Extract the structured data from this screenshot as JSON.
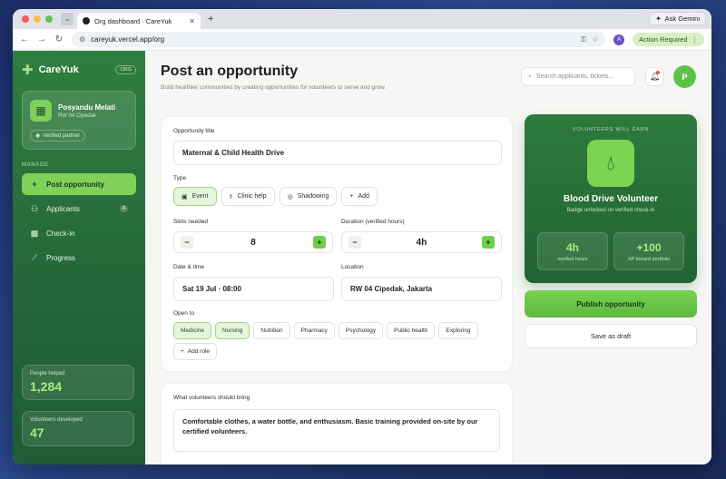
{
  "browser": {
    "tab_title": "Org dashboard · CareYuk",
    "ask_gemini": "Ask Gemini",
    "url": "careyuk.vercel.app/org",
    "profile_initial": "A",
    "action_required": "Action Required"
  },
  "sidebar": {
    "brand": "CareYuk",
    "org_badge": "ORG",
    "org_name": "Posyandu Melati",
    "org_location": "RW 04 Cipedak",
    "verified": "Verified partner",
    "section": "MANAGE",
    "items": [
      {
        "label": "Post opportunity",
        "icon": "+"
      },
      {
        "label": "Applicants",
        "icon": "users",
        "count": "4"
      },
      {
        "label": "Check-in",
        "icon": "qr"
      },
      {
        "label": "Progress",
        "icon": "chart"
      }
    ],
    "stats": [
      {
        "label": "People helped",
        "value": "1,284"
      },
      {
        "label": "Volunteers developed",
        "value": "47"
      }
    ]
  },
  "header": {
    "title": "Post an opportunity",
    "subtitle": "Build healthier communities by creating opportunities for volunteers to serve and grow.",
    "search_placeholder": "Search applicants, tickets...",
    "user_initial": "P"
  },
  "form": {
    "title_label": "Opportunity title",
    "title_value": "Maternal & Child Health Drive",
    "type_label": "Type",
    "types": [
      "Event",
      "Clinic help",
      "Shadowing",
      "Add"
    ],
    "slots_label": "Slots needed",
    "slots_value": "8",
    "duration_label": "Duration (verified hours)",
    "duration_value": "4h",
    "date_label": "Date & time",
    "date_value": "Sat 19 Jul · 08:00",
    "location_label": "Location",
    "location_value": "RW 04 Cipedak, Jakarta",
    "open_label": "Open to",
    "roles": [
      "Medicine",
      "Nursing",
      "Nutrition",
      "Pharmacy",
      "Psychology",
      "Public health",
      "Exploring"
    ],
    "add_role": "Add role"
  },
  "bring": {
    "label": "What volunteers should bring",
    "value": "Comfortable clothes, a water bottle, and enthusiasm. Basic training provided on-site by our certified volunteers."
  },
  "reward": {
    "heading": "VOLUNTEERS WILL EARN",
    "title": "Blood Drive Volunteer",
    "subtitle": "Badge unlocked on verified check-in",
    "stat1_value": "4h",
    "stat1_label": "verified hours",
    "stat2_value": "+100",
    "stat2_label": "XP toward portfolio"
  },
  "actions": {
    "publish": "Publish opportunity",
    "draft": "Save as draft"
  }
}
